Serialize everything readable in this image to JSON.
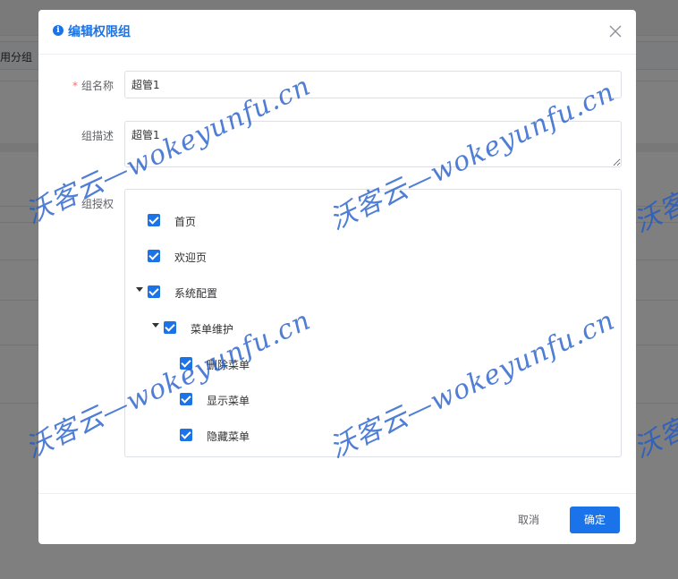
{
  "background": {
    "tab_text": "用分组"
  },
  "dialog": {
    "title": "编辑权限组",
    "form": {
      "name_required_mark": "*",
      "name_label": "组名称",
      "name_value": "超管1",
      "desc_label": "组描述",
      "desc_value": "超管1",
      "auth_label": "组授权"
    },
    "tree": [
      {
        "label": "首页",
        "checked": true,
        "level": 0,
        "expandable": false
      },
      {
        "label": "欢迎页",
        "checked": true,
        "level": 0,
        "expandable": false
      },
      {
        "label": "系统配置",
        "checked": true,
        "level": 0,
        "expandable": true
      },
      {
        "label": "菜单维护",
        "checked": true,
        "level": 1,
        "expandable": true
      },
      {
        "label": "删除菜单",
        "checked": true,
        "level": 2,
        "expandable": false
      },
      {
        "label": "显示菜单",
        "checked": true,
        "level": 2,
        "expandable": false
      },
      {
        "label": "隐藏菜单",
        "checked": true,
        "level": 2,
        "expandable": false
      }
    ],
    "footer": {
      "cancel_label": "取消",
      "ok_label": "确定"
    }
  },
  "watermark": {
    "text": "沃客云—wokeyunfu.cn"
  },
  "colors": {
    "primary": "#1a73e8",
    "required": "#f56c6c",
    "mask": "rgba(0,0,0,0.5)"
  }
}
